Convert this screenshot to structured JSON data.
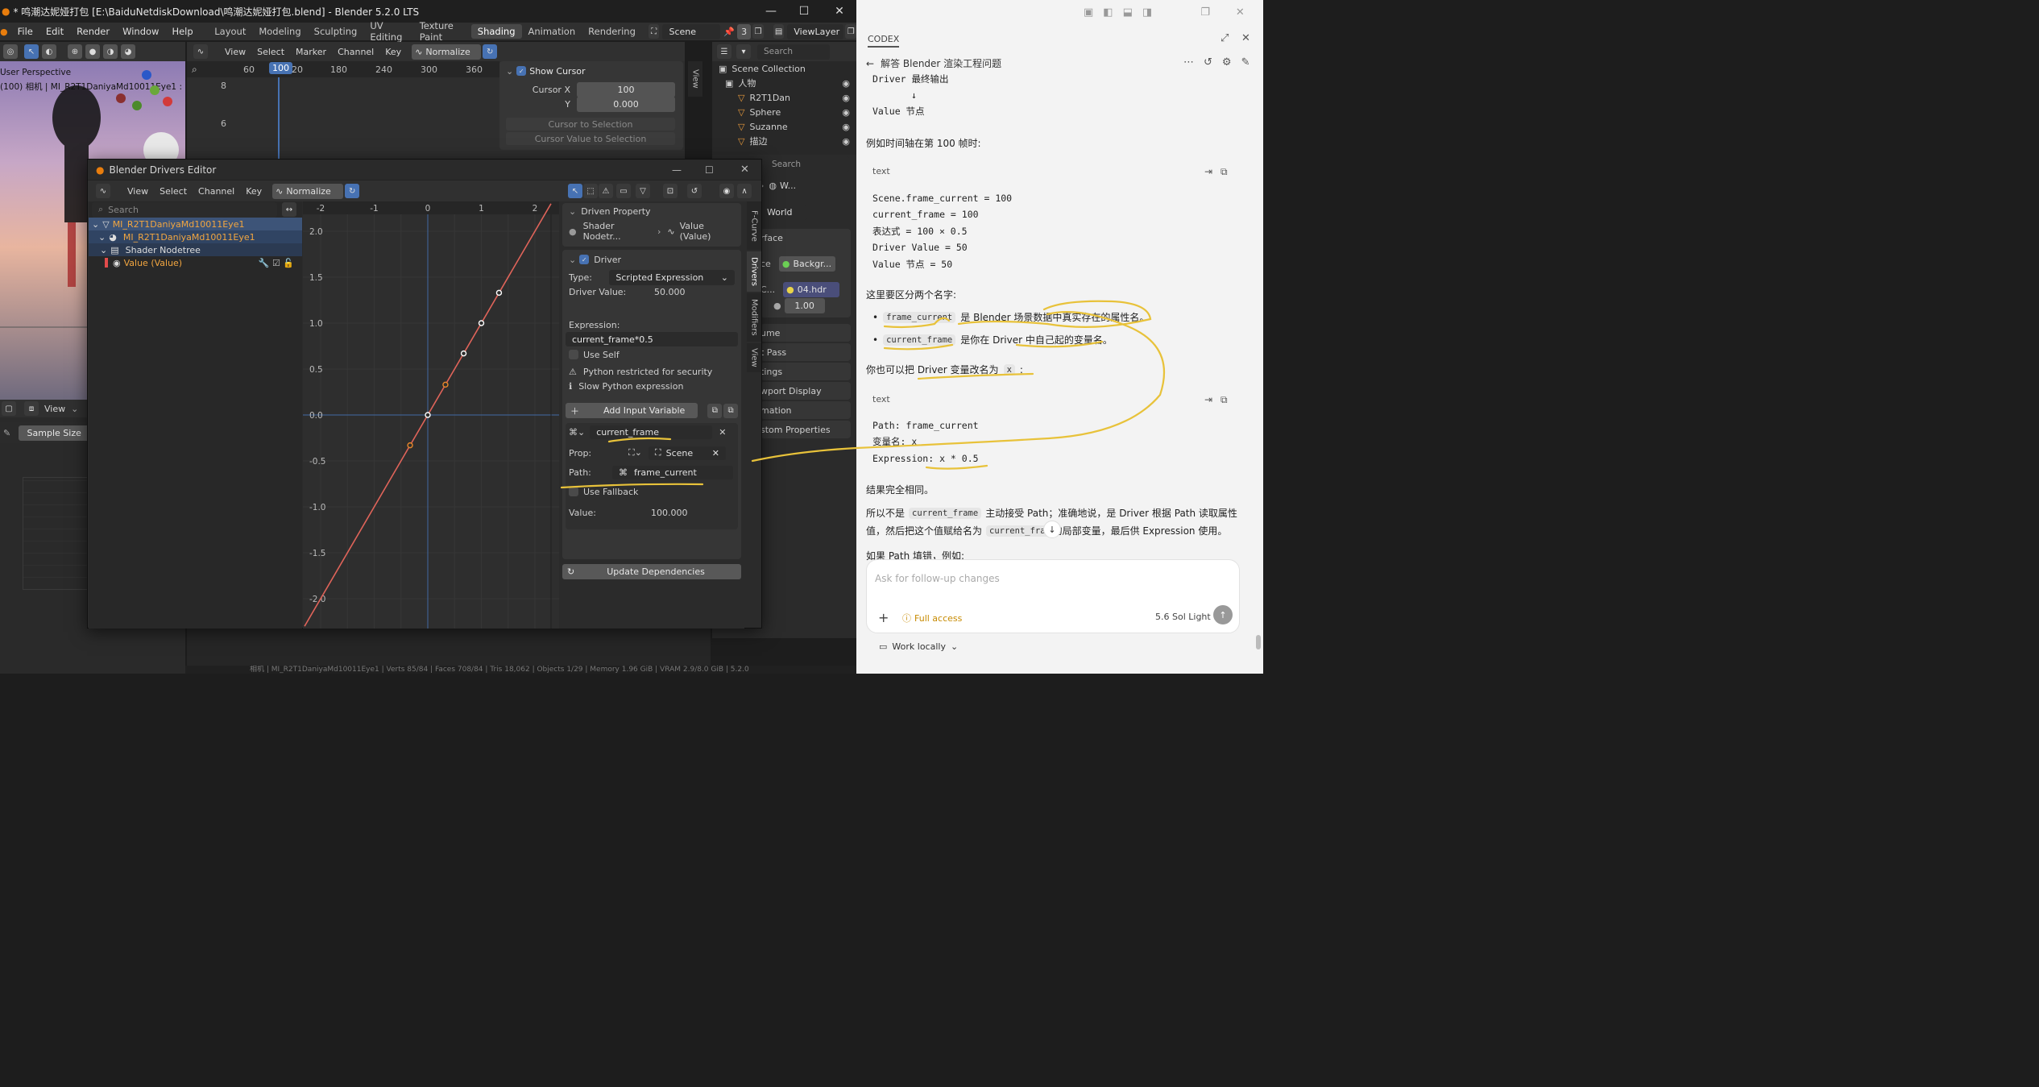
{
  "blender": {
    "title": "* 鸣潮达妮娅打包 [E:\\BaiduNetdiskDownload\\鸣潮达妮娅打包.blend] - Blender 5.2.0 LTS",
    "menus": [
      "File",
      "Edit",
      "Render",
      "Window",
      "Help"
    ],
    "workspaces": [
      "Layout",
      "Modeling",
      "Sculpting",
      "UV Editing",
      "Texture Paint",
      "Shading",
      "Animation",
      "Rendering"
    ],
    "active_workspace": "Shading",
    "scene": "Scene",
    "scene_users": "3",
    "view_layer": "ViewLayer",
    "viewport_overlay_1": "User Perspective",
    "viewport_overlay_2": "(100) 相机 | MI_R2T1DaniyaMd10011Eye1 : De",
    "top_graph_menus": [
      "View",
      "Select",
      "Marker",
      "Channel",
      "Key"
    ],
    "normalize": "Normalize",
    "top_frames": [
      "60",
      "100",
      "20",
      "180",
      "240",
      "300",
      "360"
    ],
    "current_frame": "100",
    "top_yticks": [
      "8",
      "6"
    ],
    "view_tab": "View",
    "cursor_panel": {
      "show_cursor": "Show Cursor",
      "cursor_x_label": "Cursor X",
      "cursor_x": "100",
      "y_label": "Y",
      "y_value": "0.000",
      "btn1": "Cursor to Selection",
      "btn2": "Cursor Value to Selection"
    },
    "outliner": {
      "search": "Search",
      "root": "Scene Collection",
      "collection": "人物",
      "items": [
        "R2T1Dan",
        "Sphere",
        "Suzanne",
        "描边"
      ]
    },
    "props": {
      "search": "Search",
      "w_label": "W...",
      "world": "World",
      "surface": "rface",
      "surface_label": "ce",
      "background": "Backgr...",
      "c_label": "C...",
      "hdr": "04.hdr",
      "strength": "1.00",
      "items": [
        "ume",
        "t Pass",
        "tings",
        "wport Display",
        "mation",
        "stom Properties"
      ]
    },
    "bottom_left": {
      "view": "View",
      "sample": "Sample Size"
    },
    "status": "相机 | MI_R2T1DaniyaMd10011Eye1 | Verts 85/84 | Faces 708/84 | Tris 18,062 | Objects 1/29 | Memory 1.96 GiB | VRAM 2.9/8.0 GiB | 5.2.0"
  },
  "drivers_editor": {
    "title": "Blender Drivers Editor",
    "menus": [
      "View",
      "Select",
      "Channel",
      "Key"
    ],
    "normalize": "Normalize",
    "search": "Search",
    "channels": [
      {
        "label": "MI_R2T1DaniyaMd10011Eye1"
      },
      {
        "label": "MI_R2T1DaniyaMd10011Eye1"
      },
      {
        "label": "Shader Nodetree"
      },
      {
        "label": "Value (Value)"
      }
    ],
    "x_ticks": [
      "-2",
      "-1",
      "0",
      "1",
      "2"
    ],
    "y_ticks": [
      "2.0",
      "1.5",
      "1.0",
      "0.5",
      "0.0",
      "-0.5",
      "-1.0",
      "-1.5",
      "-2.0"
    ],
    "tabs": [
      "F-Curve",
      "Drivers",
      "Modifiers",
      "View"
    ],
    "driven_property": {
      "header": "Driven Property",
      "shader": "Shader Nodetr...",
      "value": "Value (Value)"
    },
    "driver": {
      "header": "Driver",
      "type_label": "Type:",
      "type": "Scripted Expression",
      "value_label": "Driver Value:",
      "value": "50.000",
      "expr_label": "Expression:",
      "expr": "current_frame*0.5",
      "use_self": "Use Self",
      "warn1": "Python restricted for security",
      "warn2": "Slow Python expression",
      "add_var": "Add Input Variable",
      "var_name": "current_frame",
      "prop_label": "Prop:",
      "prop_value": "Scene",
      "path_label": "Path:",
      "path_value": "frame_current",
      "fallback": "Use Fallback",
      "var_value_label": "Value:",
      "var_value": "100.000",
      "update": "Update Dependencies"
    }
  },
  "chart_data": {
    "type": "line",
    "series": [
      {
        "x": [
          -2.3,
          2.3
        ],
        "y": [
          -2.3,
          2.3
        ]
      }
    ],
    "points": [
      {
        "x": -0.33,
        "y": -0.33
      },
      {
        "x": 0,
        "y": 0
      },
      {
        "x": 0.33,
        "y": 0.33
      },
      {
        "x": 0.67,
        "y": 0.67
      },
      {
        "x": 1,
        "y": 1
      },
      {
        "x": 1.33,
        "y": 1.33
      }
    ],
    "xlim": [
      -2.3,
      2.3
    ],
    "ylim": [
      -2.3,
      2.3
    ]
  },
  "codex": {
    "app": "CODEX",
    "thread": "解答 Blender 渲染工程问题",
    "line1": "Driver 最终输出",
    "arrow": "↓",
    "line2": "Value 节点",
    "p1": "例如时间轴在第 100 帧时:",
    "code1_lang": "text",
    "code1": [
      "Scene.frame_current = 100",
      "current_frame = 100",
      "表达式 = 100 × 0.5",
      "Driver Value = 50",
      "Value 节点 = 50"
    ],
    "p2": "这里要区分两个名字:",
    "b1_code": "frame_current",
    "b1_text": "是 Blender 场景数据中真实存在的属性名。",
    "b2_code": "current_frame",
    "b2_text": "是你在 Driver 中自己起的变量名。",
    "p3a": "你也可以把 Driver 变量改名为",
    "p3_code": "x",
    "p3b": ":",
    "code2_lang": "text",
    "code2": [
      "Path: frame_current",
      "变量名: x",
      "Expression: x * 0.5"
    ],
    "p4": "结果完全相同。",
    "p5a": "所以不是",
    "p5_code1": "current_frame",
    "p5b": "主动接受 Path；准确地说，是 Driver 根据 Path 读取属性",
    "p5c": "值，然后把这个值赋给名为",
    "p5_code2": "current_fra",
    "p5d": "的局部变量，最后供 Expression 使用。",
    "p6": "如果 Path 填错，例如:",
    "input_placeholder": "Ask for follow-up changes",
    "access": "Full access",
    "model": "5.6 Sol  Light",
    "work_locally": "Work locally"
  }
}
